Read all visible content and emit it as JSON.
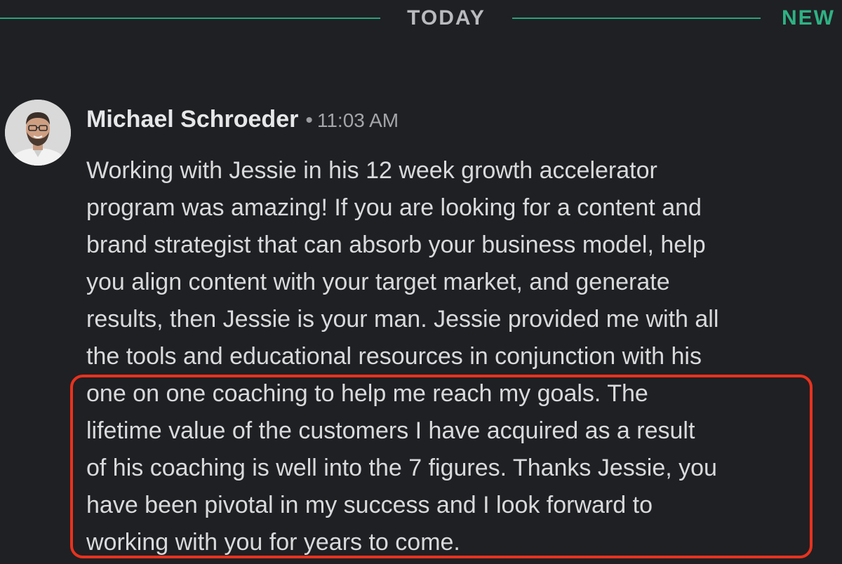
{
  "divider": {
    "date_label": "TODAY",
    "new_label": "NEW"
  },
  "message": {
    "author": "Michael Schroeder",
    "separator": "•",
    "timestamp": "11:03 AM",
    "avatar_icon": "person-avatar-icon",
    "lines": [
      "Working with Jessie in his 12 week growth accelerator",
      "program was amazing! If you are looking for a content and",
      "brand strategist that can absorb your business model, help",
      "you align content with your target market, and generate",
      "results, then Jessie is your man. Jessie provided me with all",
      "the tools and educational resources in conjunction with his",
      "one on one coaching to help me reach my goals. The",
      "lifetime value of the customers I have acquired as a result",
      "of his coaching is well into the 7 figures. Thanks Jessie, you",
      "have been pivotal in my success and I look forward to",
      "working with you for years to come."
    ]
  },
  "colors": {
    "background": "#1f2023",
    "divider_line": "#2aa07a",
    "new_label": "#2fb184",
    "highlight_border": "#e8321e"
  }
}
